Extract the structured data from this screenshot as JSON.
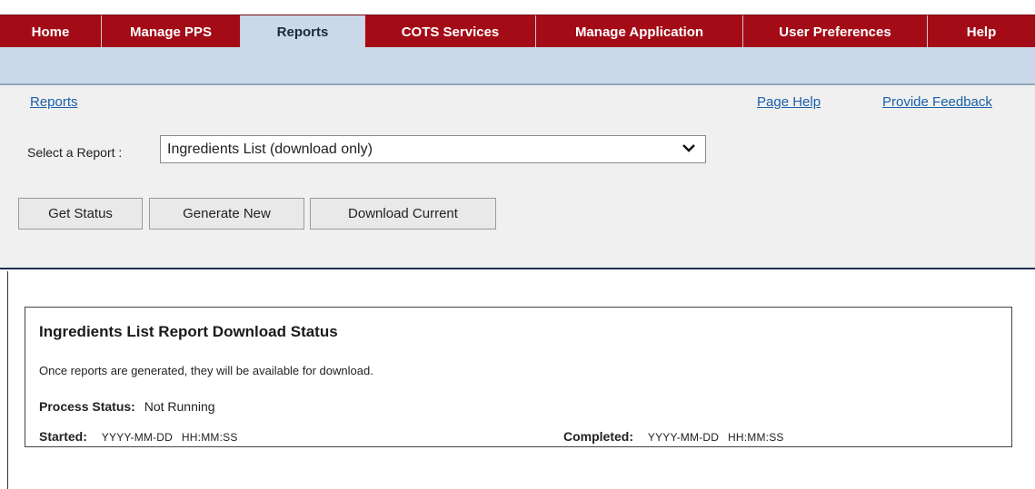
{
  "nav": {
    "tabs": [
      {
        "label": "Home"
      },
      {
        "label": "Manage PPS"
      },
      {
        "label": "Reports"
      },
      {
        "label": "COTS Services"
      },
      {
        "label": "Manage Application"
      },
      {
        "label": "User Preferences"
      },
      {
        "label": "Help"
      }
    ],
    "active": "Reports"
  },
  "links": {
    "breadcrumb": "Reports",
    "page_help": "Page Help",
    "feedback": "Provide Feedback"
  },
  "report_select": {
    "label": "Select a Report :",
    "value": "Ingredients List (download only)"
  },
  "buttons": {
    "get_status": "Get Status",
    "generate_new": "Generate New",
    "download_current": "Download Current"
  },
  "status": {
    "title": "Ingredients List Report Download Status",
    "description": "Once reports are generated, they will be available for download.",
    "process_label": "Process Status:",
    "process_value": "Not Running",
    "started_label": "Started:",
    "started_date": "YYYY-MM-DD",
    "started_time": "HH:MM:SS",
    "completed_label": "Completed:",
    "completed_date": "YYYY-MM-DD",
    "completed_time": "HH:MM:SS"
  },
  "colors": {
    "nav_bg": "#a30b17",
    "active_tab": "#c9d9ea",
    "link": "#1a5fa8"
  }
}
